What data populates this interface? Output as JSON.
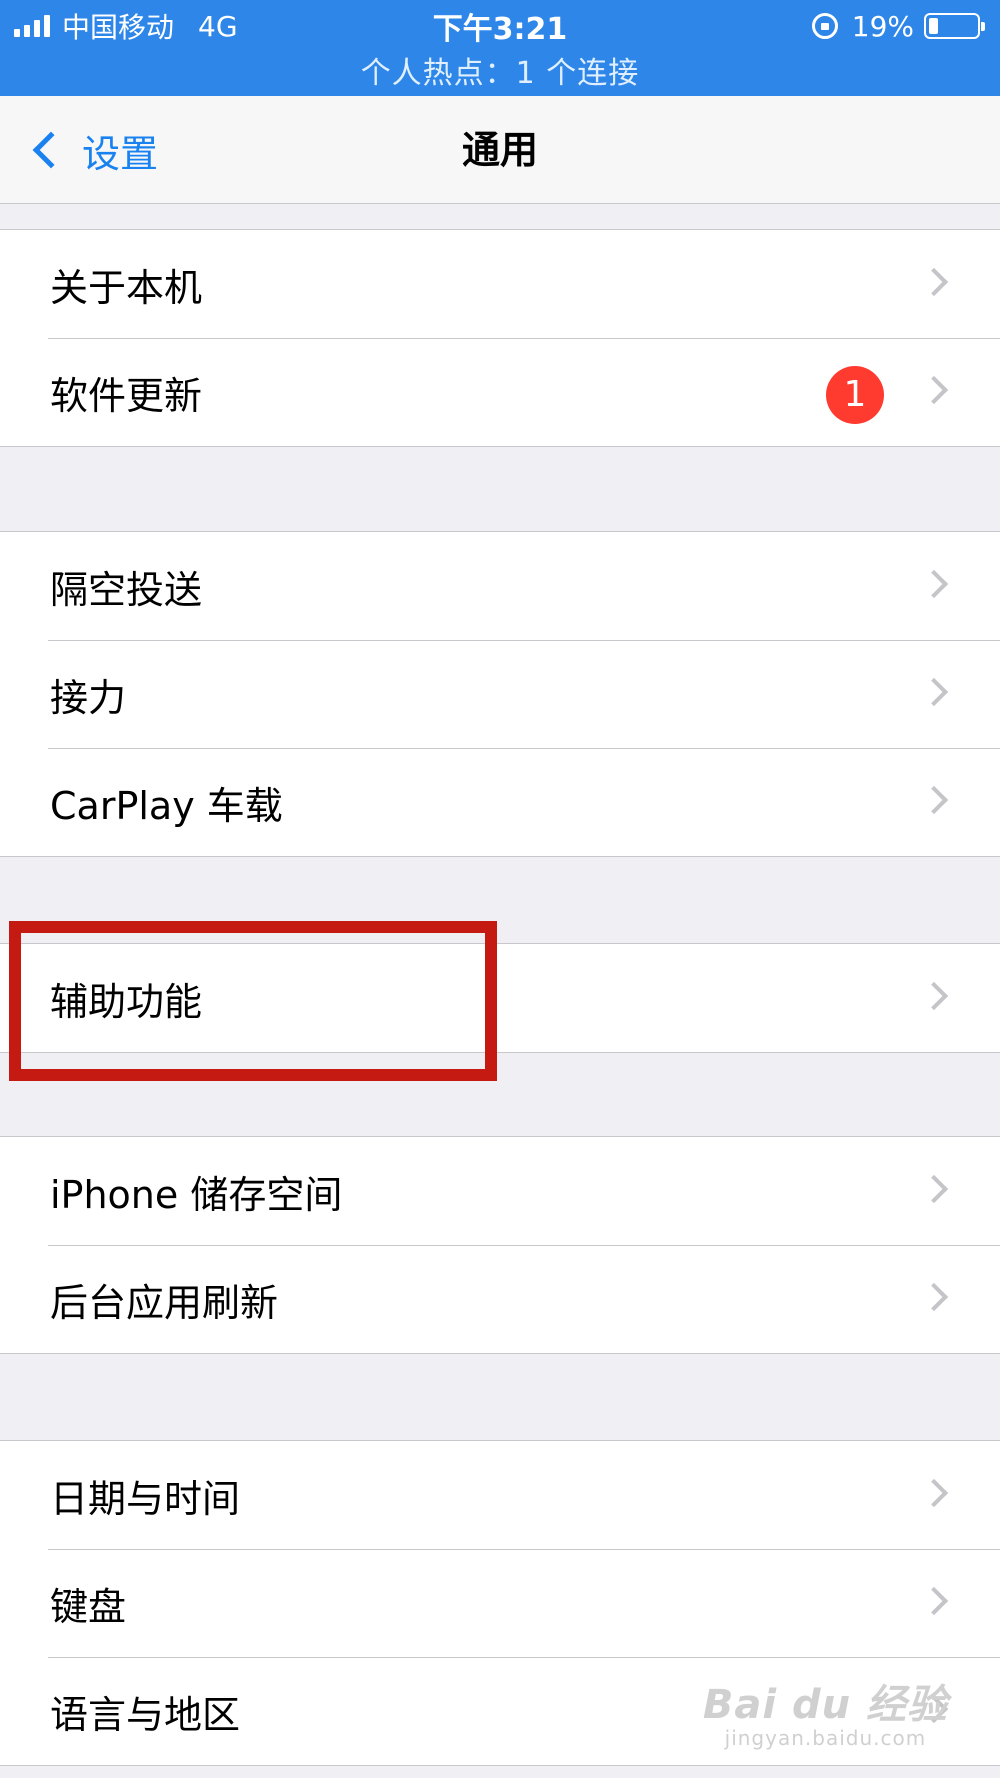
{
  "status_bar": {
    "carrier": "中国移动",
    "network": "4G",
    "time": "下午3:21",
    "battery": "19%",
    "battery_level": 0.19,
    "hotspot": "个人热点：1 个连接"
  },
  "nav": {
    "back_label": "设置",
    "title": "通用"
  },
  "groups": [
    [
      {
        "label": "关于本机"
      },
      {
        "label": "软件更新",
        "badge": "1"
      }
    ],
    [
      {
        "label": "隔空投送"
      },
      {
        "label": "接力"
      },
      {
        "label": "CarPlay 车载"
      }
    ],
    [
      {
        "label": "辅助功能"
      }
    ],
    [
      {
        "label": "iPhone 储存空间"
      },
      {
        "label": "后台应用刷新"
      }
    ],
    [
      {
        "label": "日期与时间"
      },
      {
        "label": "键盘"
      },
      {
        "label": "语言与地区"
      }
    ]
  ],
  "watermark": {
    "brand": "Bai du 经验",
    "url": "jingyan.baidu.com"
  },
  "colors": {
    "status_bar": "#2e86e8",
    "accent": "#1a82f0",
    "badge": "#ff3b30",
    "highlight_box": "#c41a12"
  }
}
